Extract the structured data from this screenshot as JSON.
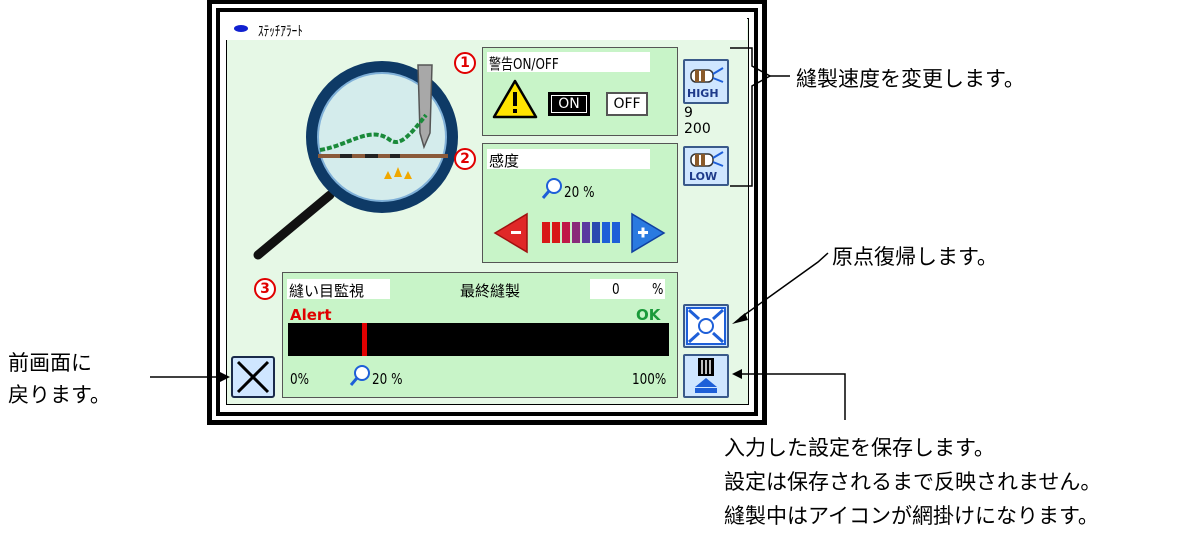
{
  "title": "ｽﾃｯﾁｱﾗｰﾄ",
  "markers": [
    "1",
    "2",
    "3"
  ],
  "warning": {
    "label": "警告ON/OFF",
    "on_label": "ON",
    "off_label": "OFF",
    "state": "ON"
  },
  "sensitivity": {
    "label": "感度",
    "value": "20 %",
    "level_fraction": 0.2
  },
  "speed": {
    "high_label": "HIGH",
    "low_label": "LOW",
    "value_line1": "9",
    "value_line2": "200"
  },
  "stitch_monitor": {
    "label": "縫い目監視",
    "last_label": "最終縫製",
    "last_value": "0",
    "last_unit": "%",
    "alert_label": "Alert",
    "ok_label": "OK",
    "scale_min": "0%",
    "scale_max": "100%",
    "threshold_value": "20 %",
    "threshold_fraction": 0.2
  },
  "annotations": {
    "speed": "縫製速度を変更します。",
    "origin": "原点復帰します。",
    "back": [
      "前画面に",
      "戻ります。"
    ],
    "save": [
      "入力した設定を保存します。",
      "設定は保存されるまで反映されません。",
      "縫製中はアイコンが網掛けになります。"
    ]
  },
  "colors": {
    "screen_bg": "#e6f8e6",
    "panel_bg": "#c8f4c8",
    "alert": "#e00000",
    "ok": "#1a9a3a",
    "accent_blue": "#1e5fd8"
  }
}
